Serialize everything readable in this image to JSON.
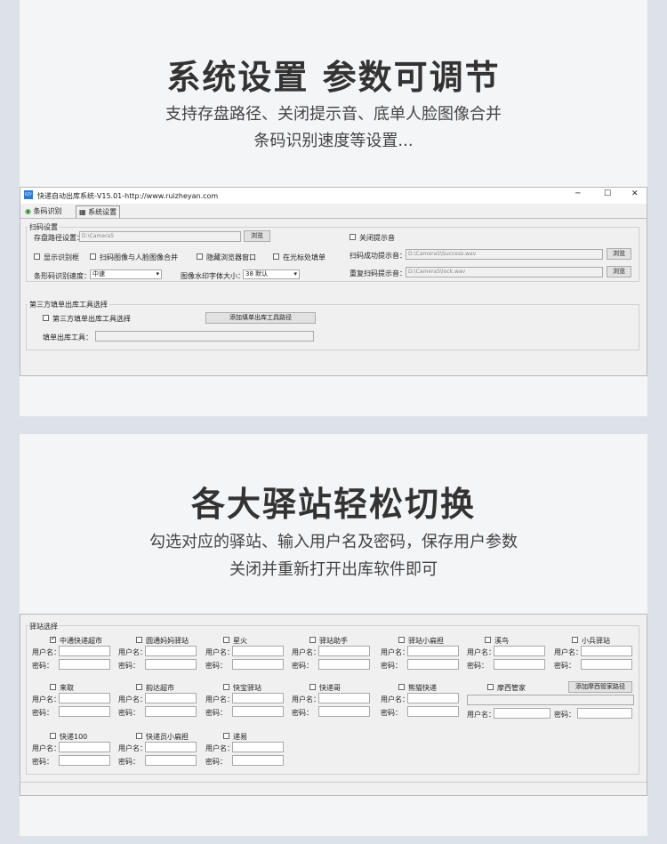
{
  "panel1": {
    "title": "系统设置 参数可调节",
    "sub1": "支持存盘路径、关闭提示音、底单人脸图像合并",
    "sub2": "条码识别速度等设置..."
  },
  "app": {
    "title": "快递自动出库系统-V15.01-http://www.ruizheyan.com",
    "logo": "RZY",
    "tab1": "条码识别",
    "tab2": "系统设置",
    "minimize": "─",
    "maximize": "☐",
    "close": "✕",
    "scan_group": "扫码设置",
    "save_path_label": "存盘路径设置：",
    "save_path": "D:\\Camera5",
    "browse": "浏览",
    "close_tone": "关闭提示音",
    "show_frame": "显示识别框",
    "merge_face": "扫码图像与人脸图像合并",
    "hide_browser": "隐藏浏览器窗口",
    "cursor_fill": "在光标处填单",
    "success_tone_label": "扫码成功提示音：",
    "success_tone": "D:\\Camera5\\Success.wav",
    "repeat_tone_label": "重复扫码提示音：",
    "repeat_tone": "D:\\Camera5\\lock.wav",
    "speed_label": "条形码识别速度：",
    "speed": "中速",
    "font_label": "图像水印字体大小：",
    "font_size": "38 默认",
    "third_group": "第三方填单出库工具选择",
    "third_cb": "第三方填单出库工具选择",
    "add_third": "添加填单出库工具路径",
    "third_tool_label": "填单出库工具："
  },
  "panel2": {
    "title": "各大驿站轻松切换",
    "sub1": "勾选对应的驿站、输入用户名及密码，保存用户参数",
    "sub2": "关闭并重新打开出库软件即可"
  },
  "stations": {
    "group": "驿站选择",
    "user": "用户名：",
    "pwd": "密码：",
    "row1": [
      "中通快递超市",
      "圆通妈妈驿站",
      "星火",
      "驿站助手",
      "驿站小扁担",
      "溪鸟",
      "小兵驿站"
    ],
    "row2": [
      "来取",
      "韵达超市",
      "快宝驿站",
      "快递哥",
      "熊猫快递"
    ],
    "mochi": "摩西管家",
    "add_mochi": "添加摩西管家路径",
    "row3": [
      "快递100",
      "快递员小扁担",
      "递易"
    ]
  }
}
